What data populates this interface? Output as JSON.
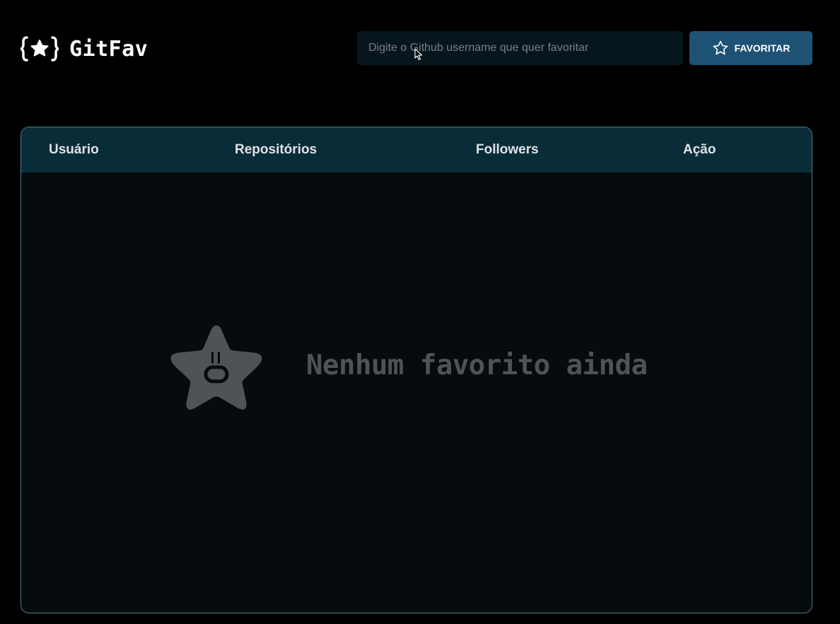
{
  "header": {
    "logo_text": "GitFav",
    "search_placeholder": "Digite o Github username que quer favoritar",
    "favorite_button_label": "FAVORITAR"
  },
  "table": {
    "columns": [
      "Usuário",
      "Repositórios",
      "Followers",
      "Ação"
    ],
    "rows": []
  },
  "empty_state": {
    "message": "Nenhum favorito ainda",
    "icon": "sad-star-icon"
  },
  "icons": {
    "logo": "braces-star-icon",
    "button": "star-outline-icon"
  },
  "colors": {
    "background": "#000000",
    "input_background": "#06161c",
    "button_background": "#1e5275",
    "table_header": "#092d38",
    "table_body": "#060b0e",
    "table_border": "#4a808c",
    "empty_text": "#4e5455"
  }
}
